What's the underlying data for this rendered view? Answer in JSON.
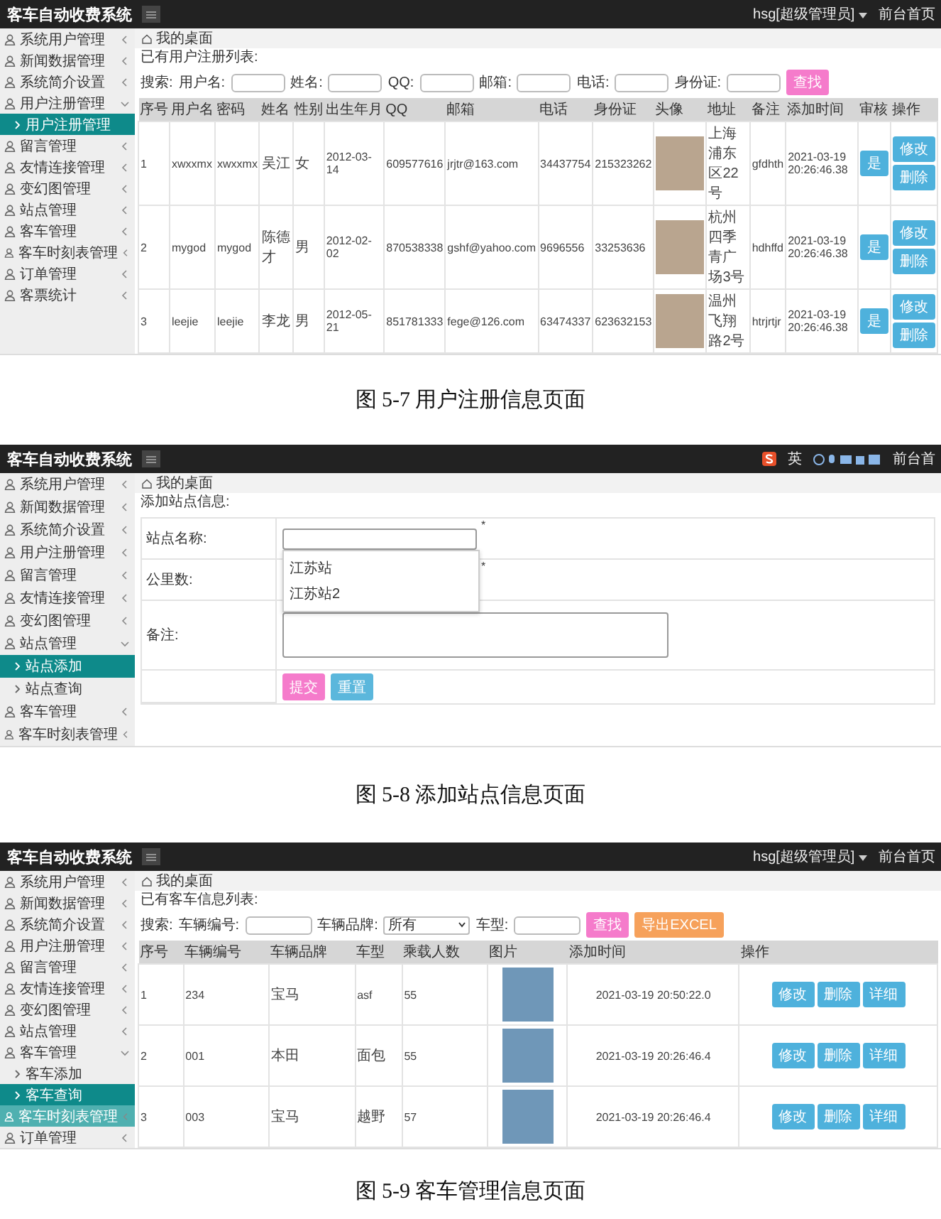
{
  "figures": [
    {
      "caption": "图 5-7 用户注册信息页面",
      "screen": {
        "kind": "table_list",
        "app_title": "客车自动收费系统",
        "user_menu": "hsg[超级管理员]",
        "home_link": "前台首页",
        "breadcrumb": "我的桌面",
        "sidebar": [
          {
            "label": "系统用户管理",
            "expanded": false
          },
          {
            "label": "新闻数据管理",
            "expanded": false
          },
          {
            "label": "系统简介设置",
            "expanded": false
          },
          {
            "label": "用户注册管理",
            "expanded": true,
            "children": [
              {
                "label": "用户注册管理",
                "selected": true
              }
            ]
          },
          {
            "label": "留言管理",
            "expanded": false
          },
          {
            "label": "友情连接管理",
            "expanded": false
          },
          {
            "label": "变幻图管理",
            "expanded": false
          },
          {
            "label": "站点管理",
            "expanded": false
          },
          {
            "label": "客车管理",
            "expanded": false
          },
          {
            "label": "客车时刻表管理",
            "expanded": false
          },
          {
            "label": "订单管理",
            "expanded": false
          },
          {
            "label": "客票统计",
            "expanded": false
          }
        ],
        "list_title": "已有用户注册列表:",
        "search_prefix": "搜索:",
        "search_fields": [
          {
            "label": "用户名:",
            "kind": "input"
          },
          {
            "label": "姓名:",
            "kind": "input"
          },
          {
            "label": "QQ:",
            "kind": "input"
          },
          {
            "label": "邮箱:",
            "kind": "input"
          },
          {
            "label": "电话:",
            "kind": "input"
          },
          {
            "label": "身份证:",
            "kind": "input"
          }
        ],
        "search_buttons": [
          {
            "label": "查找",
            "kind": "find"
          }
        ],
        "table": {
          "columns": [
            "序号",
            "用户名",
            "密码",
            "姓名",
            "性别",
            "出生年月",
            "QQ",
            "邮箱",
            "电话",
            "身份证",
            "头像",
            "地址",
            "备注",
            "添加时间",
            "审核",
            "操作"
          ],
          "rows": [
            [
              "1",
              "xwxxmx",
              "xwxxmx",
              "吴江",
              "女",
              "2012-03-14",
              "609577616",
              "jrjtr@163.com",
              "34437754",
              "215323262",
              {
                "kind": "photo"
              },
              "上海浦东区22号",
              "gfdhth",
              "2021-03-19 20:26:46.38",
              {
                "kind": "buttons",
                "labels": [
                  "是"
                ]
              },
              {
                "kind": "buttons",
                "labels": [
                  "修改",
                  "删除"
                ]
              }
            ],
            [
              "2",
              "mygod",
              "mygod",
              "陈德才",
              "男",
              "2012-02-02",
              "870538338",
              "gshf@yahoo.com",
              "9696556",
              "33253636",
              {
                "kind": "photo"
              },
              "杭州四季青广场3号",
              "hdhffd",
              "2021-03-19 20:26:46.38",
              {
                "kind": "buttons",
                "labels": [
                  "是"
                ]
              },
              {
                "kind": "buttons",
                "labels": [
                  "修改",
                  "删除"
                ]
              }
            ],
            [
              "3",
              "leejie",
              "leejie",
              "李龙",
              "男",
              "2012-05-21",
              "851781333",
              "fege@126.com",
              "63474337",
              "623632153",
              {
                "kind": "photo"
              },
              "温州飞翔路2号",
              "htrjrtjr",
              "2021-03-19 20:26:46.38",
              {
                "kind": "buttons",
                "labels": [
                  "是"
                ]
              },
              {
                "kind": "buttons",
                "labels": [
                  "修改",
                  "删除"
                ]
              }
            ]
          ]
        }
      }
    },
    {
      "caption": "图 5-8 添加站点信息页面",
      "screen": {
        "kind": "form",
        "app_title": "客车自动收费系统",
        "ime_label": "英",
        "home_link": "前台首",
        "breadcrumb": "我的桌面",
        "sidebar": [
          {
            "label": "系统用户管理",
            "expanded": false
          },
          {
            "label": "新闻数据管理",
            "expanded": false
          },
          {
            "label": "系统简介设置",
            "expanded": false
          },
          {
            "label": "用户注册管理",
            "expanded": false
          },
          {
            "label": "留言管理",
            "expanded": false
          },
          {
            "label": "友情连接管理",
            "expanded": false
          },
          {
            "label": "变幻图管理",
            "expanded": false
          },
          {
            "label": "站点管理",
            "expanded": true,
            "children": [
              {
                "label": "站点添加",
                "selected": true
              },
              {
                "label": "站点查询",
                "selected": false
              }
            ]
          },
          {
            "label": "客车管理",
            "expanded": false
          },
          {
            "label": "客车时刻表管理",
            "expanded": false
          }
        ],
        "form_title": "添加站点信息:",
        "fields": [
          {
            "label": "站点名称:",
            "kind": "input",
            "required_mark": "*",
            "suggestions": [
              "江苏站",
              "江苏站2"
            ]
          },
          {
            "label": "公里数:",
            "kind": "input",
            "required_mark": "*"
          },
          {
            "label": "备注:",
            "kind": "textarea"
          }
        ],
        "buttons": [
          {
            "label": "提交",
            "kind": "submit"
          },
          {
            "label": "重置",
            "kind": "reset"
          }
        ]
      }
    },
    {
      "caption": "图 5-9 客车管理信息页面",
      "screen": {
        "kind": "table_list",
        "app_title": "客车自动收费系统",
        "user_menu": "hsg[超级管理员]",
        "home_link": "前台首页",
        "breadcrumb": "我的桌面",
        "sidebar": [
          {
            "label": "系统用户管理",
            "expanded": false,
            "hovered": false
          },
          {
            "label": "新闻数据管理",
            "expanded": false,
            "hovered": false
          },
          {
            "label": "系统简介设置",
            "expanded": false,
            "hovered": false
          },
          {
            "label": "用户注册管理",
            "expanded": false,
            "hovered": false
          },
          {
            "label": "留言管理",
            "expanded": false,
            "hovered": false
          },
          {
            "label": "友情连接管理",
            "expanded": false,
            "hovered": false
          },
          {
            "label": "变幻图管理",
            "expanded": false,
            "hovered": false
          },
          {
            "label": "站点管理",
            "expanded": false,
            "hovered": false
          },
          {
            "label": "客车管理",
            "expanded": true,
            "hovered": false,
            "children": [
              {
                "label": "客车添加",
                "selected": false
              },
              {
                "label": "客车查询",
                "selected": true
              }
            ]
          },
          {
            "label": "客车时刻表管理",
            "expanded": false,
            "hovered": true
          },
          {
            "label": "订单管理",
            "expanded": false,
            "hovered": false
          }
        ],
        "list_title": "已有客车信息列表:",
        "search_prefix": "搜索:",
        "search_fields": [
          {
            "label": "车辆编号:",
            "kind": "input"
          },
          {
            "label": "车辆品牌:",
            "kind": "select",
            "value": "所有"
          },
          {
            "label": "车型:",
            "kind": "input"
          }
        ],
        "search_buttons": [
          {
            "label": "查找",
            "kind": "find"
          },
          {
            "label": "导出EXCEL",
            "kind": "export"
          }
        ],
        "table": {
          "columns": [
            "序号",
            "车辆编号",
            "车辆品牌",
            "车型",
            "乘载人数",
            "图片",
            "添加时间",
            "操作"
          ],
          "rows": [
            [
              "1",
              "234",
              "宝马",
              "asf",
              "55",
              {
                "kind": "photo"
              },
              "2021-03-19 20:50:22.0",
              {
                "kind": "buttons",
                "labels": [
                  "修改",
                  "删除",
                  "详细"
                ]
              }
            ],
            [
              "2",
              "001",
              "本田",
              "面包",
              "55",
              {
                "kind": "photo"
              },
              "2021-03-19 20:26:46.4",
              {
                "kind": "buttons",
                "labels": [
                  "修改",
                  "删除",
                  "详细"
                ]
              }
            ],
            [
              "3",
              "003",
              "宝马",
              "越野",
              "57",
              {
                "kind": "photo"
              },
              "2021-03-19 20:26:46.4",
              {
                "kind": "buttons",
                "labels": [
                  "修改",
                  "删除",
                  "详细"
                ]
              }
            ]
          ]
        }
      }
    }
  ]
}
